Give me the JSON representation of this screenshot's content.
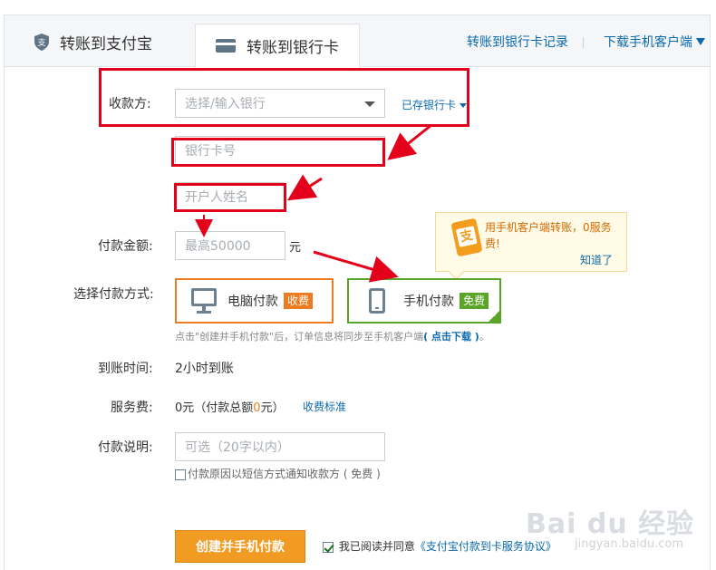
{
  "tabs": {
    "alipay": "转账到支付宝",
    "bank": "转账到银行卡"
  },
  "top_links": {
    "record": "转账到银行卡记录",
    "download": "下载手机客户端"
  },
  "form": {
    "payee_label": "收款方:",
    "bank_placeholder": "选择/输入银行",
    "saved_cards": "已存银行卡",
    "card_placeholder": "银行卡号",
    "name_placeholder": "开户人姓名",
    "amount_label": "付款金额:",
    "amount_placeholder": "最高50000",
    "amount_unit": "元",
    "method_label": "选择付款方式:",
    "pc_pay": "电脑付款",
    "pc_badge": "收费",
    "phone_pay": "手机付款",
    "phone_badge": "免费",
    "hint_prefix": "点击\"创建并手机付款\"后，订单信息将同步至手机客户端",
    "hint_link": "( 点击下载 )",
    "hint_suffix": "。",
    "arrival_label": "到账时间:",
    "arrival_value": "2小时到账",
    "fee_label": "服务费:",
    "fee_value_a": "0元（付款总额",
    "fee_value_b": "0",
    "fee_value_c": "元）",
    "fee_standard": "收费标准",
    "note_label": "付款说明:",
    "note_placeholder": "可选（20字以内）",
    "sms_notice": "付款原因以短信方式通知收款方 ( 免费 )",
    "submit": "创建并手机付款",
    "agree_text": "我已阅读并同意",
    "agreement_link": "《支付宝付款到卡服务协议》"
  },
  "tooltip": {
    "icon_char": "支",
    "text": "用手机客户端转账，0服务费!",
    "dismiss": "知道了"
  },
  "watermark": {
    "logo": "Bai du 经验",
    "url": "jingyan.baidu.com"
  },
  "colors": {
    "accent_blue": "#0b6aab",
    "annotation_red": "#e3001b",
    "pc_orange": "#ee7b1f",
    "phone_green": "#5aa428",
    "submit_orange": "#f29b22"
  }
}
